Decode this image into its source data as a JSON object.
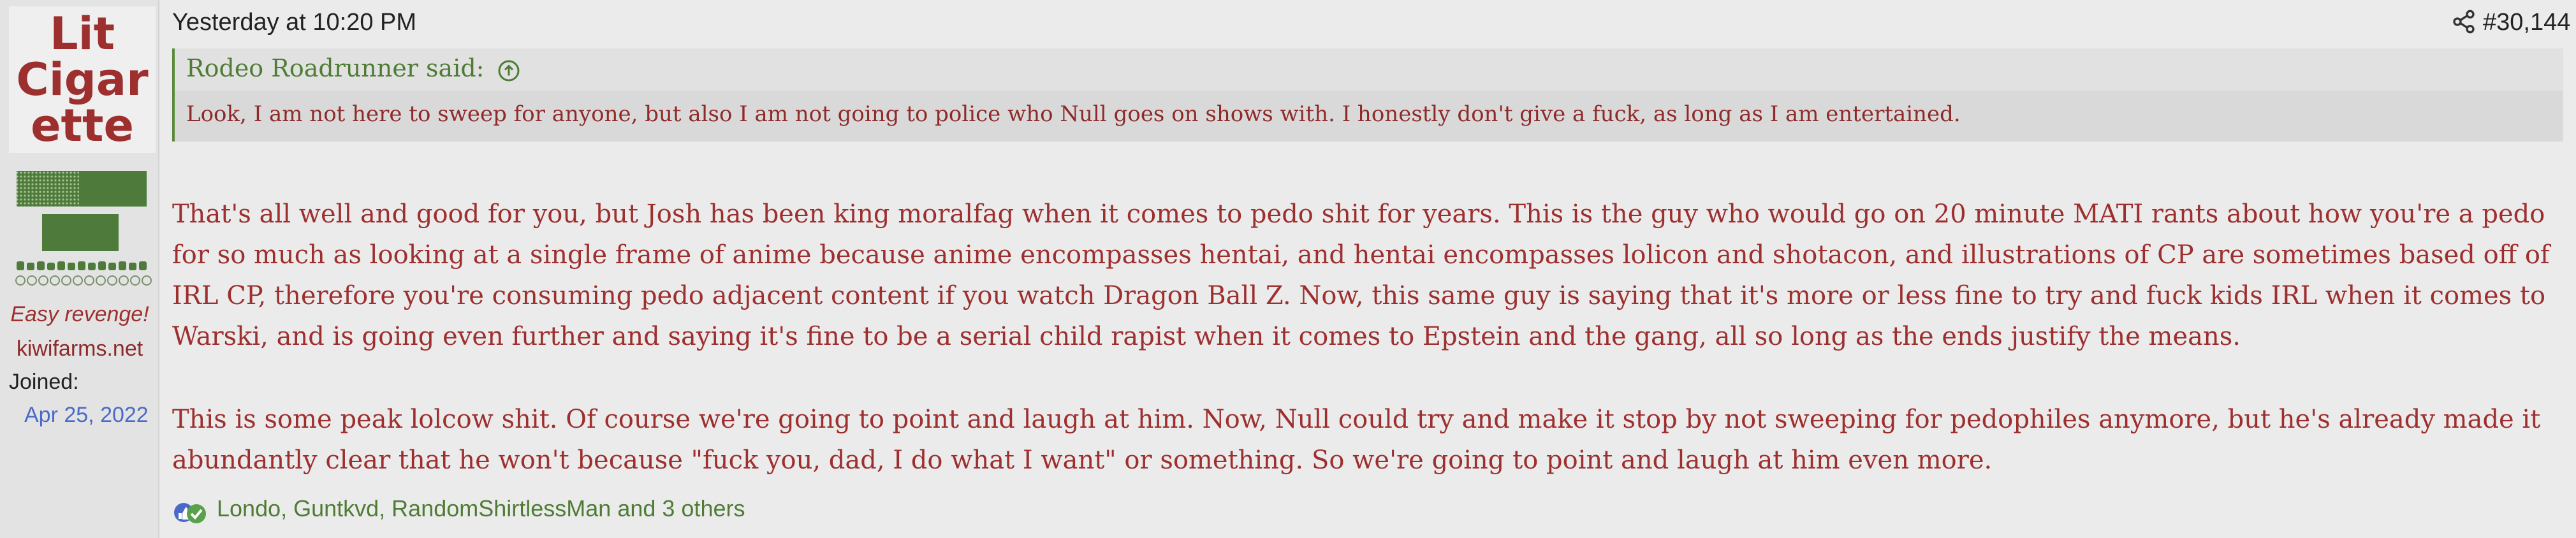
{
  "sidebar": {
    "avatar_text": [
      "Lit",
      "Cigar",
      "ette"
    ],
    "user_title": "Easy revenge!",
    "user_site": "kiwifarms.net",
    "joined_label": "Joined:",
    "joined_value": "Apr 25, 2022"
  },
  "post": {
    "timestamp": "Yesterday at 10:20 PM",
    "post_number": "#30,144",
    "share_icon": "share-icon",
    "quote": {
      "attribution": "Rodeo Roadrunner said:",
      "expand_icon": "arrow-up-icon",
      "text": "Look, I am not here to sweep for anyone, but also I am not going to police who Null goes on shows with. I honestly don't give a fuck, as long as I am entertained."
    },
    "paragraphs": [
      "That's all well and good for you, but Josh has been king moralfag when it comes to pedo shit for years. This is the guy who would go on 20 minute MATI rants about how you're a pedo for so much as looking at a single frame of anime because anime encompasses hentai, and hentai encompasses lolicon and shotacon, and illustrations of CP are sometimes based off of IRL CP, therefore you're consuming pedo adjacent content if you watch Dragon Ball Z. Now, this same guy is saying that it's more or less fine to try and fuck kids IRL when it comes to Warski, and is going even further and saying it's fine to be a serial child rapist when it comes to Epstein and the gang, all so long as the ends justify the means.",
      "This is some peak lolcow shit. Of course we're going to point and laugh at him. Now, Null could try and make it stop by not sweeping for pedophiles anymore, but he's already made it abundantly clear that he won't because \"fuck you, dad, I do what I want\" or something. So we're going to point and laugh at him even more."
    ],
    "reactions": {
      "icons": [
        "like-icon",
        "check-icon"
      ],
      "names": "Londo, Guntkvd, RandomShirtlessMan and 3 others"
    }
  },
  "colors": {
    "text_red": "#9e2f2f",
    "quote_green": "#4f7c35",
    "link_blue": "#4a6ac7",
    "background": "#ebebeb",
    "sidebar_bg": "#e3e3e3"
  }
}
